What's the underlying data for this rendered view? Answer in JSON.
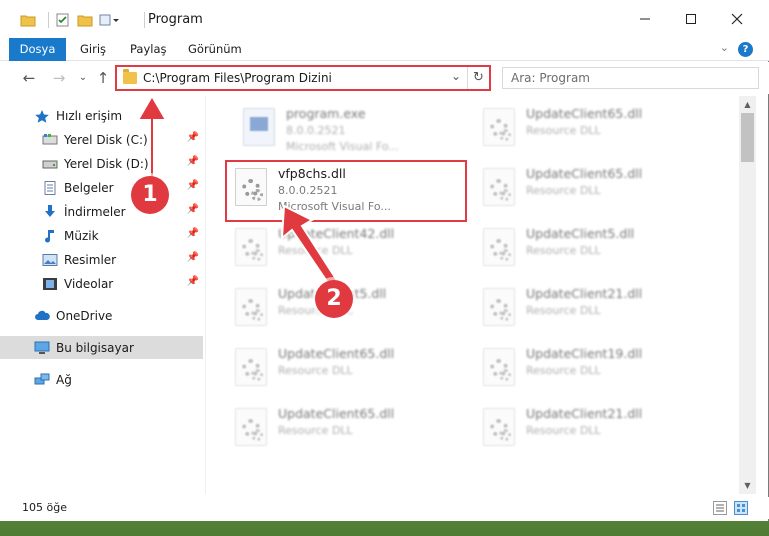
{
  "window": {
    "title": "Program"
  },
  "ribbon": {
    "tabs": [
      "Dosya",
      "Giriş",
      "Paylaş",
      "Görünüm"
    ]
  },
  "address": {
    "path": "C:\\Program Files\\Program Dizini"
  },
  "search": {
    "placeholder": "Ara: Program"
  },
  "nav": {
    "quick_access": "Hızlı erişim",
    "items": [
      "Yerel Disk (C:)",
      "Yerel Disk (D:)",
      "Belgeler",
      "İndirmeler",
      "Müzik",
      "Resimler",
      "Videolar"
    ],
    "onedrive": "OneDrive",
    "this_pc": "Bu bilgisayar",
    "network": "Ağ"
  },
  "files": [
    {
      "name": "program.exe",
      "version": "8.0.0.2521",
      "type": "Microsoft Visual Fo..."
    },
    {
      "name": "UpdateClient65.dll",
      "type": "Resource DLL"
    },
    {
      "name": "vfp8chs.dll",
      "version": "8.0.0.2521",
      "type": "Microsoft Visual Fo..."
    },
    {
      "name": "UpdateClient65.dll",
      "type": "Resource DLL"
    },
    {
      "name": "UpdateClient42.dll",
      "type": "Resource DLL"
    },
    {
      "name": "UpdateClient5.dll",
      "type": "Resource DLL"
    },
    {
      "name": "UpdateClient5.dll",
      "type": "Resource DLL"
    },
    {
      "name": "UpdateClient21.dll",
      "type": "Resource DLL"
    },
    {
      "name": "UpdateClient65.dll",
      "type": "Resource DLL"
    },
    {
      "name": "UpdateClient19.dll",
      "type": "Resource DLL"
    },
    {
      "name": "UpdateClient65.dll",
      "type": "Resource DLL"
    },
    {
      "name": "UpdateClient21.dll",
      "type": "Resource DLL"
    }
  ],
  "status": {
    "count": "105 öğe"
  },
  "annotations": {
    "step1": "1",
    "step2": "2"
  },
  "colors": {
    "accent": "#1979ca",
    "annotation": "#e03a45"
  }
}
